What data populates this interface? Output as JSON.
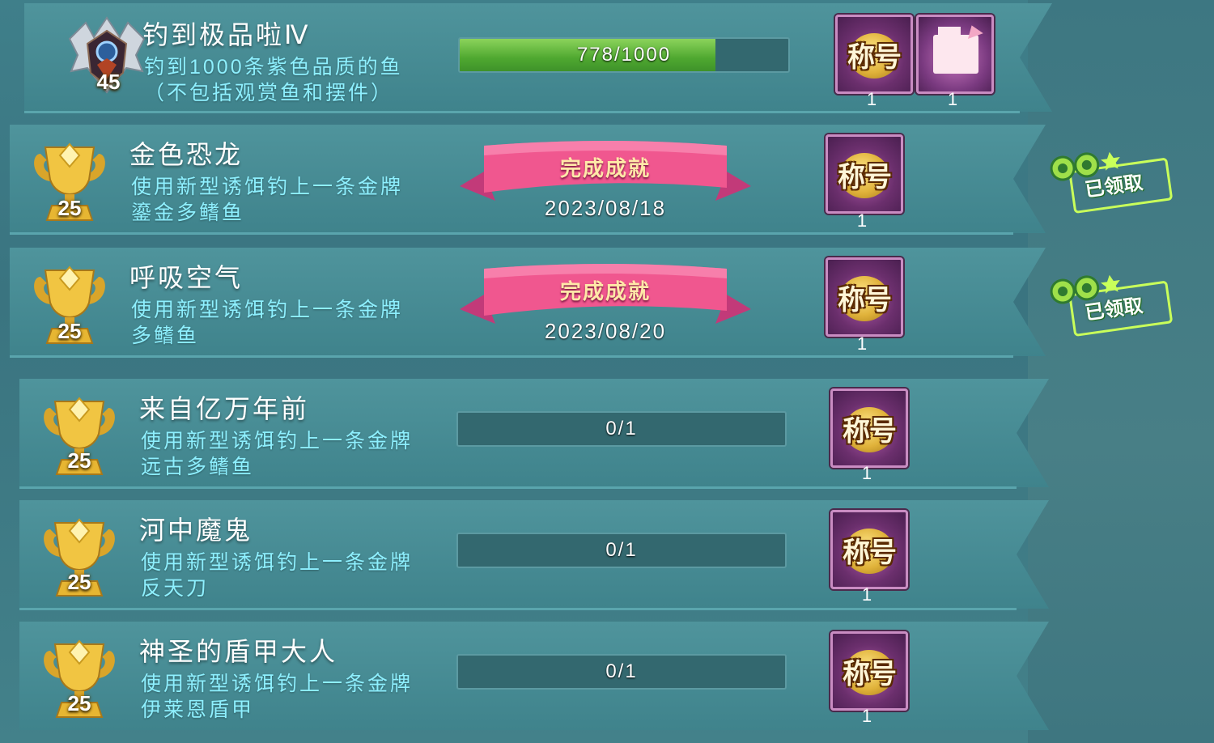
{
  "achievements": [
    {
      "level": "45",
      "title": "钓到极品啦Ⅳ",
      "desc_lines": [
        "钓到1000条紫色品质的鱼",
        "（不包括观赏鱼和摆件）"
      ],
      "status": "in_progress",
      "progress_text": "778/1000",
      "progress_fraction": 0.778,
      "rewards": [
        {
          "icon": "title-badge-icon",
          "label": "称号",
          "qty": "1"
        },
        {
          "icon": "card-icon",
          "label": "",
          "qty": "1"
        }
      ]
    },
    {
      "level": "25",
      "title": "金色恐龙",
      "desc_lines": [
        "使用新型诱饵钓上一条金牌",
        "鎏金多鳍鱼"
      ],
      "status": "completed",
      "ribbon_text": "完成成就",
      "date": "2023/08/18",
      "claimed_text": "已领取",
      "rewards": [
        {
          "icon": "title-badge-icon",
          "label": "称号",
          "qty": "1"
        }
      ]
    },
    {
      "level": "25",
      "title": "呼吸空气",
      "desc_lines": [
        "使用新型诱饵钓上一条金牌",
        "多鳍鱼"
      ],
      "status": "completed",
      "ribbon_text": "完成成就",
      "date": "2023/08/20",
      "claimed_text": "已领取",
      "rewards": [
        {
          "icon": "title-badge-icon",
          "label": "称号",
          "qty": "1"
        }
      ]
    },
    {
      "level": "25",
      "title": "来自亿万年前",
      "desc_lines": [
        "使用新型诱饵钓上一条金牌",
        "远古多鳍鱼"
      ],
      "status": "in_progress",
      "progress_text": "0/1",
      "progress_fraction": 0,
      "rewards": [
        {
          "icon": "title-badge-icon",
          "label": "称号",
          "qty": "1"
        }
      ]
    },
    {
      "level": "25",
      "title": "河中魔鬼",
      "desc_lines": [
        "使用新型诱饵钓上一条金牌",
        "反天刀"
      ],
      "status": "in_progress",
      "progress_text": "0/1",
      "progress_fraction": 0,
      "rewards": [
        {
          "icon": "title-badge-icon",
          "label": "称号",
          "qty": "1"
        }
      ]
    },
    {
      "level": "25",
      "title": "神圣的盾甲大人",
      "desc_lines": [
        "使用新型诱饵钓上一条金牌",
        "伊莱恩盾甲"
      ],
      "status": "in_progress",
      "progress_text": "0/1",
      "progress_fraction": 0,
      "rewards": [
        {
          "icon": "title-badge-icon",
          "label": "称号",
          "qty": "1"
        }
      ]
    }
  ]
}
